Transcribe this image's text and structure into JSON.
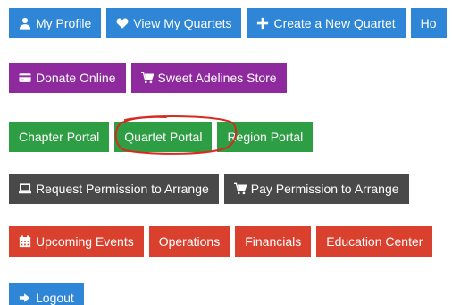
{
  "rows": {
    "main_nav": [
      {
        "label": "My Profile",
        "icon": "user-icon"
      },
      {
        "label": "View My Quartets",
        "icon": "heart-icon"
      },
      {
        "label": "Create a New Quartet",
        "icon": "plus-icon"
      },
      {
        "label": "Ho",
        "icon": ""
      }
    ],
    "support": [
      {
        "label": "Donate Online",
        "icon": "credit-card-icon"
      },
      {
        "label": "Sweet Adelines Store",
        "icon": "shopping-cart-icon"
      }
    ],
    "portals": [
      {
        "label": "Chapter Portal"
      },
      {
        "label": "Quartet Portal"
      },
      {
        "label": "Region Portal"
      }
    ],
    "arranging": [
      {
        "label": "Request Permission to Arrange",
        "icon": "laptop-icon"
      },
      {
        "label": "Pay Permission to Arrange",
        "icon": "shopping-cart-icon"
      }
    ],
    "info": [
      {
        "label": "Upcoming Events",
        "icon": "calendar-icon"
      },
      {
        "label": "Operations"
      },
      {
        "label": "Financials"
      },
      {
        "label": "Education Center"
      }
    ],
    "account": [
      {
        "label": "Logout",
        "icon": "sign-out-icon"
      }
    ]
  },
  "colors": {
    "blue": "#2f86d6",
    "purple": "#8e2a9e",
    "green": "#2e9e45",
    "dark": "#494949",
    "red": "#d9412e",
    "annotation": "#d62a1e"
  }
}
